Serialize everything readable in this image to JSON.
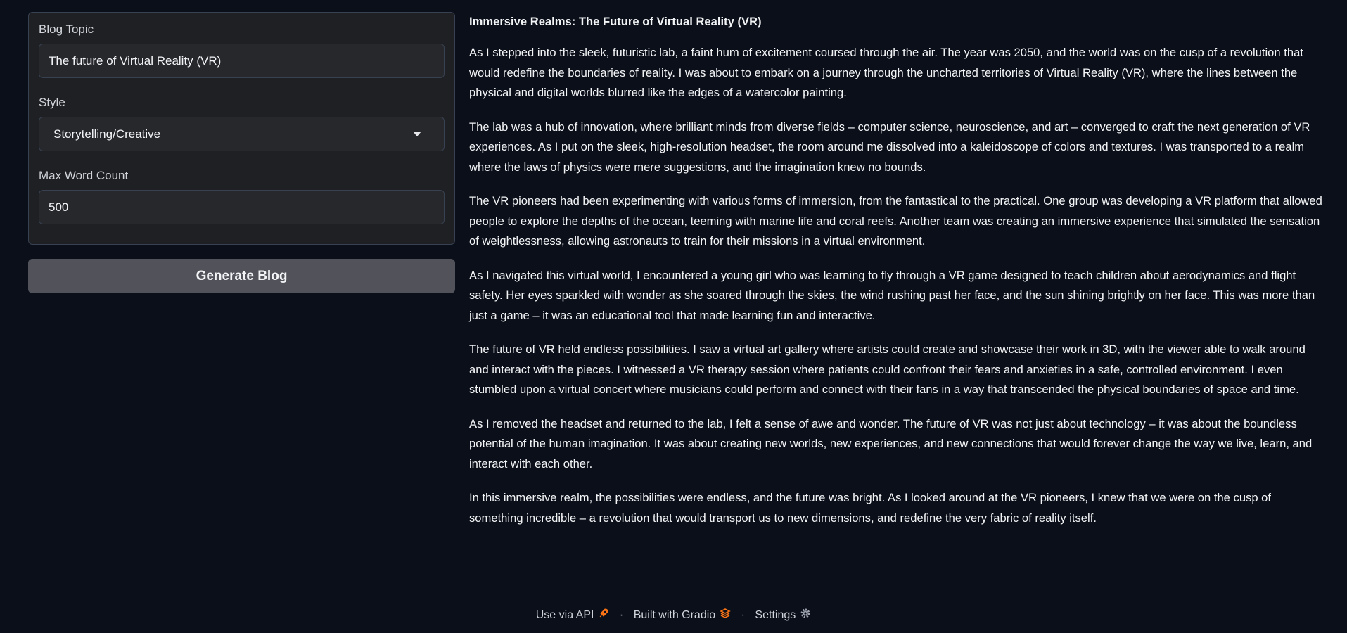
{
  "form": {
    "topic_label": "Blog Topic",
    "topic_value": "The future of Virtual Reality (VR)",
    "style_label": "Style",
    "style_value": "Storytelling/Creative",
    "max_words_label": "Max Word Count",
    "max_words_value": "500",
    "generate_button": "Generate Blog"
  },
  "output": {
    "title": "Immersive Realms: The Future of Virtual Reality (VR)",
    "paragraphs": [
      "As I stepped into the sleek, futuristic lab, a faint hum of excitement coursed through the air. The year was 2050, and the world was on the cusp of a revolution that would redefine the boundaries of reality. I was about to embark on a journey through the uncharted territories of Virtual Reality (VR), where the lines between the physical and digital worlds blurred like the edges of a watercolor painting.",
      "The lab was a hub of innovation, where brilliant minds from diverse fields – computer science, neuroscience, and art – converged to craft the next generation of VR experiences. As I put on the sleek, high-resolution headset, the room around me dissolved into a kaleidoscope of colors and textures. I was transported to a realm where the laws of physics were mere suggestions, and the imagination knew no bounds.",
      "The VR pioneers had been experimenting with various forms of immersion, from the fantastical to the practical. One group was developing a VR platform that allowed people to explore the depths of the ocean, teeming with marine life and coral reefs. Another team was creating an immersive experience that simulated the sensation of weightlessness, allowing astronauts to train for their missions in a virtual environment.",
      "As I navigated this virtual world, I encountered a young girl who was learning to fly through a VR game designed to teach children about aerodynamics and flight safety. Her eyes sparkled with wonder as she soared through the skies, the wind rushing past her face, and the sun shining brightly on her face. This was more than just a game – it was an educational tool that made learning fun and interactive.",
      "The future of VR held endless possibilities. I saw a virtual art gallery where artists could create and showcase their work in 3D, with the viewer able to walk around and interact with the pieces. I witnessed a VR therapy session where patients could confront their fears and anxieties in a safe, controlled environment. I even stumbled upon a virtual concert where musicians could perform and connect with their fans in a way that transcended the physical boundaries of space and time.",
      "As I removed the headset and returned to the lab, I felt a sense of awe and wonder. The future of VR was not just about technology – it was about the boundless potential of the human imagination. It was about creating new worlds, new experiences, and new connections that would forever change the way we live, learn, and interact with each other.",
      "In this immersive realm, the possibilities were endless, and the future was bright. As I looked around at the VR pioneers, I knew that we were on the cusp of something incredible – a revolution that would transport us to new dimensions, and redefine the very fabric of reality itself."
    ]
  },
  "footer": {
    "api": "Use via API",
    "sep": "·",
    "built": "Built with Gradio",
    "settings": "Settings",
    "icons": [
      "rocket-icon",
      "gradio-logo-icon",
      "gear-icon"
    ]
  }
}
